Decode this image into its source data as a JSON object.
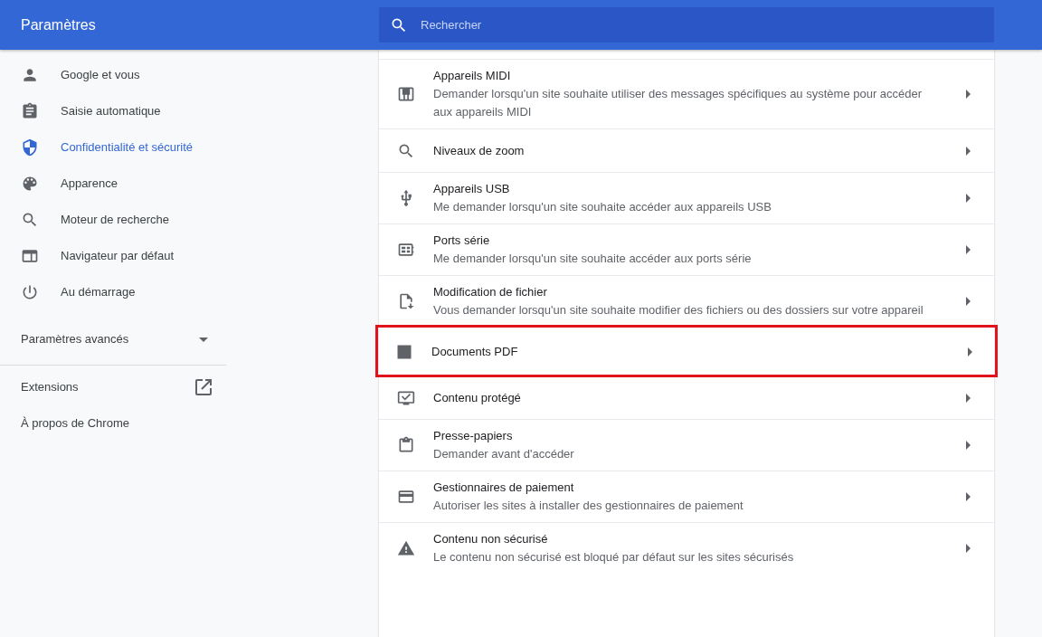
{
  "header": {
    "title": "Paramètres",
    "search": {
      "placeholder": "Rechercher"
    }
  },
  "sidebar": {
    "items": [
      {
        "label": "Google et vous",
        "selected": false
      },
      {
        "label": "Saisie automatique",
        "selected": false
      },
      {
        "label": "Confidentialité et sécurité",
        "selected": true
      },
      {
        "label": "Apparence",
        "selected": false
      },
      {
        "label": "Moteur de recherche",
        "selected": false
      },
      {
        "label": "Navigateur par défaut",
        "selected": false
      },
      {
        "label": "Au démarrage",
        "selected": false
      }
    ],
    "advanced": {
      "label": "Paramètres avancés",
      "expanded": false
    },
    "links": [
      {
        "label": "Extensions",
        "external": true
      },
      {
        "label": "À propos de Chrome",
        "external": false
      }
    ]
  },
  "settings": [
    {
      "title": "Appareils MIDI",
      "description": "Demander lorsqu'un site souhaite utiliser des messages spécifiques au système pour accéder aux appareils MIDI",
      "highlighted": false
    },
    {
      "title": "Niveaux de zoom",
      "highlighted": false
    },
    {
      "title": "Appareils USB",
      "description": "Me demander lorsqu'un site souhaite accéder aux appareils USB",
      "highlighted": false
    },
    {
      "title": "Ports série",
      "description": "Me demander lorsqu'un site souhaite accéder aux ports série",
      "highlighted": false
    },
    {
      "title": "Modification de fichier",
      "description": "Vous demander lorsqu'un site souhaite modifier des fichiers ou des dossiers sur votre appareil",
      "highlighted": false
    },
    {
      "title": "Documents PDF",
      "highlighted": true
    },
    {
      "title": "Contenu protégé",
      "highlighted": false
    },
    {
      "title": "Presse-papiers",
      "description": "Demander avant d'accéder",
      "highlighted": false
    },
    {
      "title": "Gestionnaires de paiement",
      "description": "Autoriser les sites à installer des gestionnaires de paiement",
      "highlighted": false
    },
    {
      "title": "Contenu non sécurisé",
      "description": "Le contenu non sécurisé est bloqué par défaut sur les sites sécurisés",
      "highlighted": false
    }
  ]
}
